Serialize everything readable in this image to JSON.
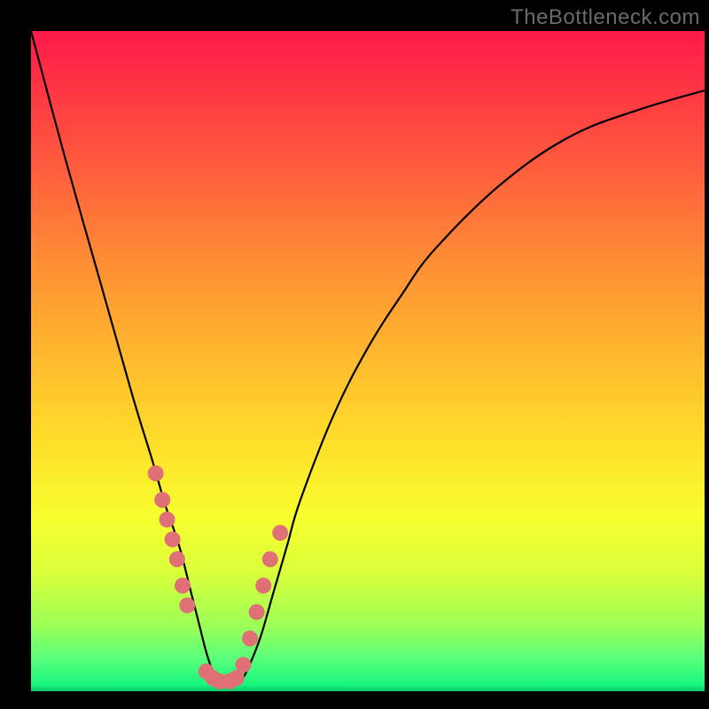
{
  "watermark": "TheBottleneck.com",
  "chart_data": {
    "type": "line",
    "title": "",
    "xlabel": "",
    "ylabel": "",
    "xlim": [
      0,
      100
    ],
    "ylim": [
      0,
      100
    ],
    "grid": false,
    "legend": false,
    "annotations": [],
    "series": [
      {
        "name": "bottleneck-curve",
        "x": [
          0,
          5,
          10,
          15,
          18,
          20,
          22,
          24,
          25,
          26,
          27,
          28,
          29,
          30,
          31,
          32,
          34,
          36,
          38,
          40,
          45,
          50,
          55,
          60,
          70,
          80,
          90,
          100
        ],
        "y": [
          100,
          81,
          63,
          45,
          35,
          28,
          22,
          14,
          10,
          6,
          3,
          1.5,
          1,
          1,
          1.5,
          3,
          8,
          15,
          22,
          29,
          42,
          52,
          60,
          67,
          77,
          84,
          88,
          91
        ]
      }
    ],
    "markers": {
      "name": "highlight-points",
      "x": [
        18.5,
        19.5,
        20.2,
        21,
        21.7,
        22.5,
        23.2,
        26,
        27,
        28,
        29.5,
        30.5,
        31.5,
        32.5,
        33.5,
        34.5,
        35.5,
        37
      ],
      "y": [
        33,
        29,
        26,
        23,
        20,
        16,
        13,
        3,
        2,
        1.5,
        1.5,
        2,
        4,
        8,
        12,
        16,
        20,
        24
      ]
    },
    "background_gradient": {
      "type": "vertical",
      "stops": [
        {
          "pos": 0,
          "color": "#ff1a4b"
        },
        {
          "pos": 20,
          "color": "#ff5a3e"
        },
        {
          "pos": 48,
          "color": "#ffb52e"
        },
        {
          "pos": 74,
          "color": "#f7ff2e"
        },
        {
          "pos": 95,
          "color": "#5aff7b"
        },
        {
          "pos": 100,
          "color": "#0cc56a"
        }
      ]
    }
  }
}
